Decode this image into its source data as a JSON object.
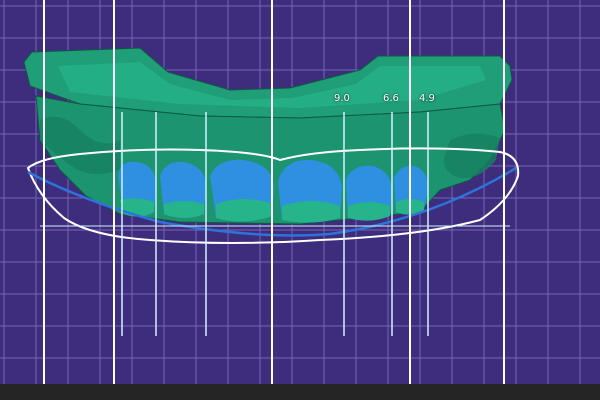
{
  "viewer": {
    "background_color": "#3d2d7c",
    "grid_color": "#7565b3",
    "guide_line_color": "#ffffff",
    "guide_line_light_color": "#d4f0ff",
    "model_color": "#1f9e78",
    "model_dark_color": "#136e52",
    "tooth_mockup_color": "#2f8fe0",
    "smile_curve_color": "#2e73d9",
    "lip_outline_color": "#ffffff"
  },
  "measurements": [
    {
      "label": "9.0"
    },
    {
      "label": "6.6"
    },
    {
      "label": "4.9"
    }
  ],
  "status_bar": {
    "text": ""
  }
}
